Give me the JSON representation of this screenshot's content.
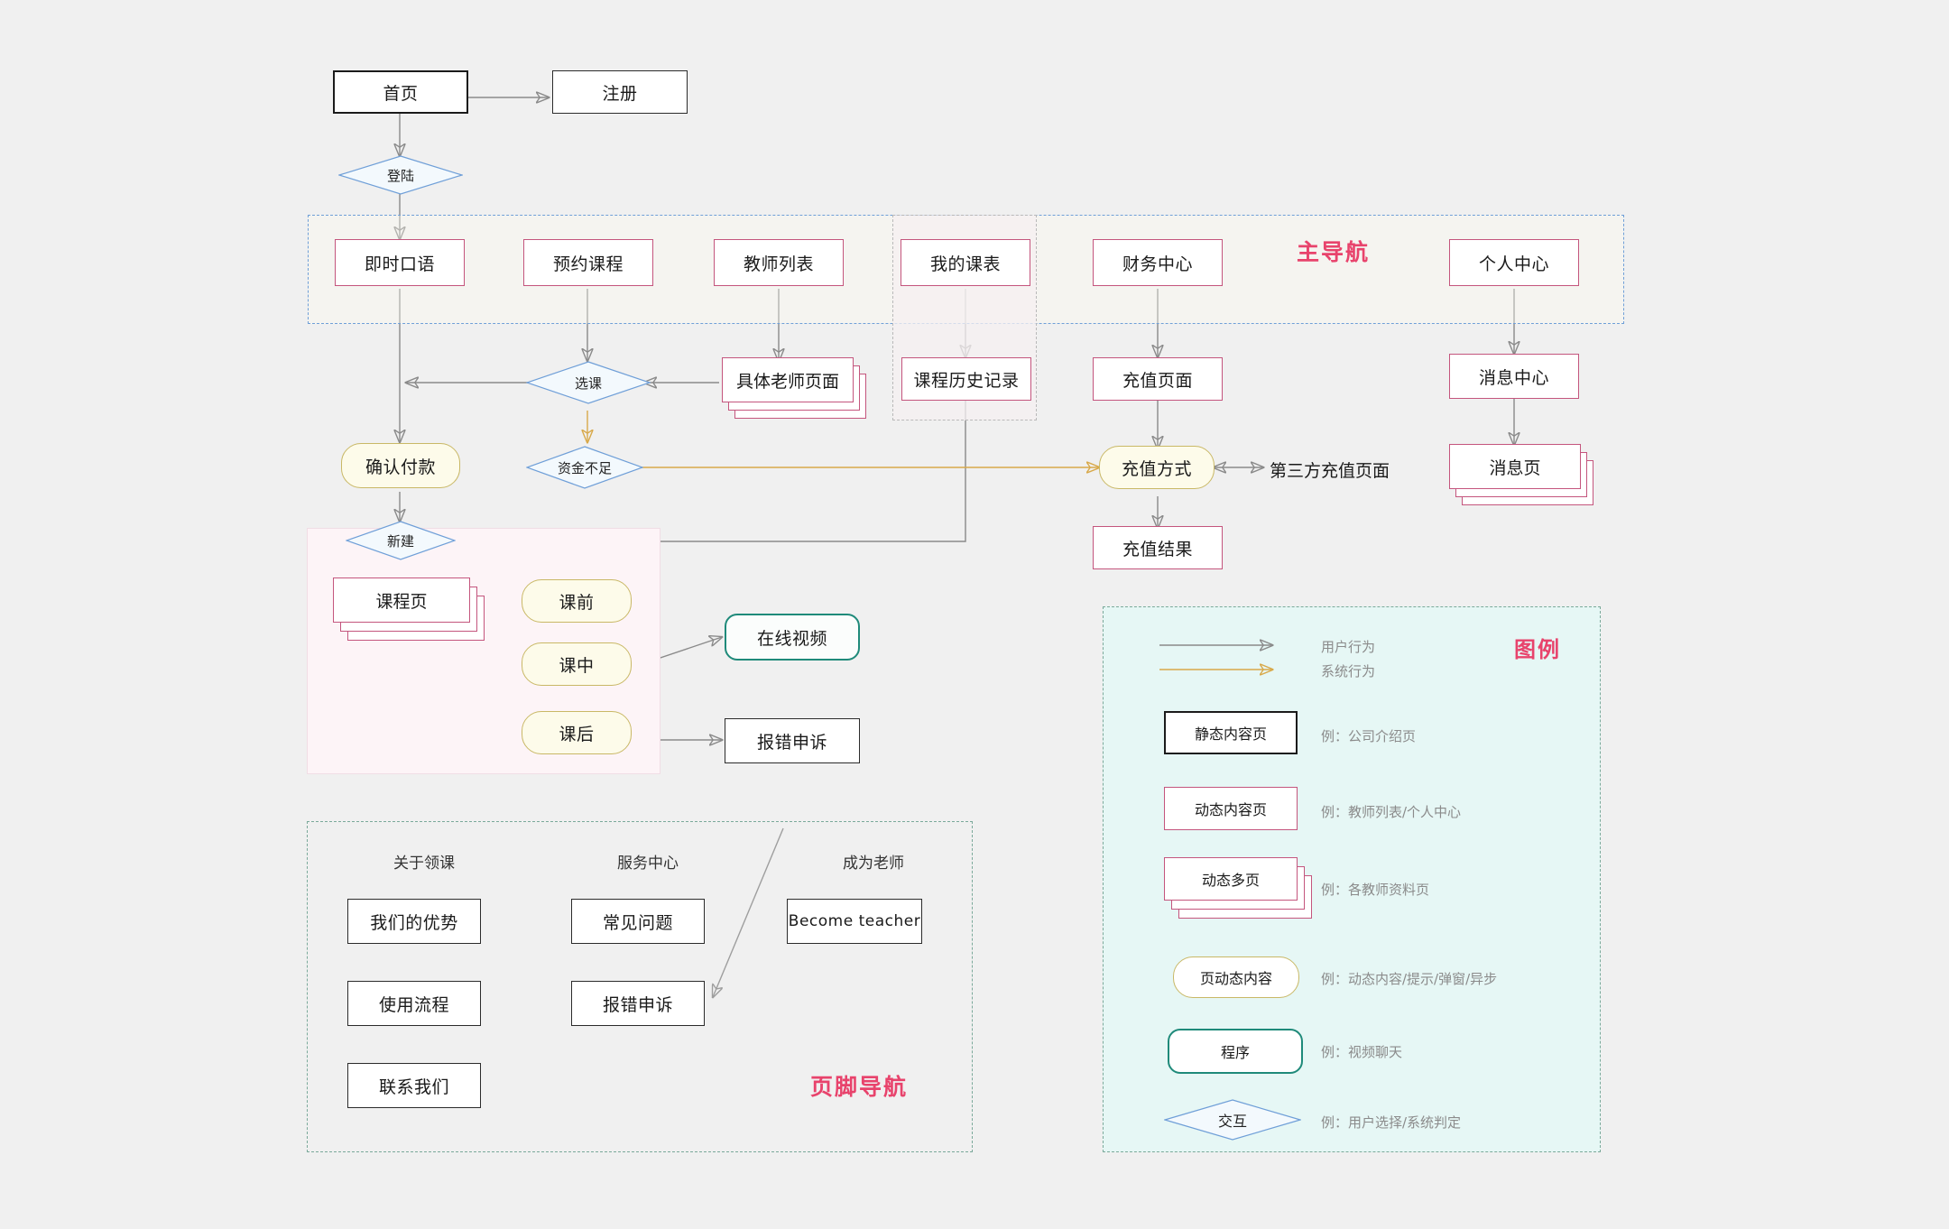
{
  "diagram": {
    "title_zones": {
      "main_nav": "主导航",
      "footer_nav": "页脚导航",
      "legend": "图例"
    },
    "top": {
      "home": "首页",
      "register": "注册",
      "login_decision": "登陆"
    },
    "main_nav_items": [
      "即时口语",
      "预约课程",
      "教师列表",
      "我的课表",
      "财务中心",
      "个人中心"
    ],
    "flow": {
      "select_course": "选课",
      "teacher_page": "具体老师页面",
      "course_history": "课程历史记录",
      "topup_page": "充值页面",
      "message_center": "消息中心",
      "confirm_payment": "确认付款",
      "insufficient_funds": "资金不足",
      "topup_method": "充值方式",
      "third_party_topup": "第三方充值页面",
      "message_page": "消息页",
      "topup_result": "充值结果",
      "new_decision": "新建",
      "course_page": "课程页",
      "before_class": "课前",
      "during_class": "课中",
      "after_class": "课后",
      "online_video": "在线视频",
      "error_report": "报错申诉"
    },
    "footer": {
      "columns": [
        {
          "title": "关于领课",
          "items": [
            "我们的优势",
            "使用流程",
            "联系我们"
          ]
        },
        {
          "title": "服务中心",
          "items": [
            "常见问题",
            "报错申诉"
          ]
        },
        {
          "title": "成为老师",
          "items": [
            "Become teacher"
          ]
        }
      ]
    },
    "legend": {
      "arrows": [
        {
          "label": "用户行为",
          "color": "#8a8a8a"
        },
        {
          "label": "系统行为",
          "color": "#d8a94a"
        }
      ],
      "shapes": [
        {
          "label": "静态内容页",
          "example": "例：公司介绍页",
          "style": "black-rect"
        },
        {
          "label": "动态内容页",
          "example": "例：教师列表/个人中心",
          "style": "pink-rect"
        },
        {
          "label": "动态多页",
          "example": "例：各教师资料页",
          "style": "pink-stack"
        },
        {
          "label": "页动态内容",
          "example": "例：动态内容/提示/弹窗/异步",
          "style": "yellow-round"
        },
        {
          "label": "程序",
          "example": "例：视频聊天",
          "style": "teal-round"
        },
        {
          "label": "交互",
          "example": "例：用户选择/系统判定",
          "style": "diamond"
        }
      ]
    },
    "colors": {
      "background": "#f0f0f0",
      "accent_pink": "#e8436c",
      "node_pink": "#c4557d",
      "node_yellow": "#c9b866",
      "node_teal": "#1f8a7a",
      "diamond_blue": "#6f9fd8",
      "user_arrow": "#8a8a8a",
      "system_arrow": "#d8a94a",
      "legend_bg": "#e6f7f5"
    }
  }
}
